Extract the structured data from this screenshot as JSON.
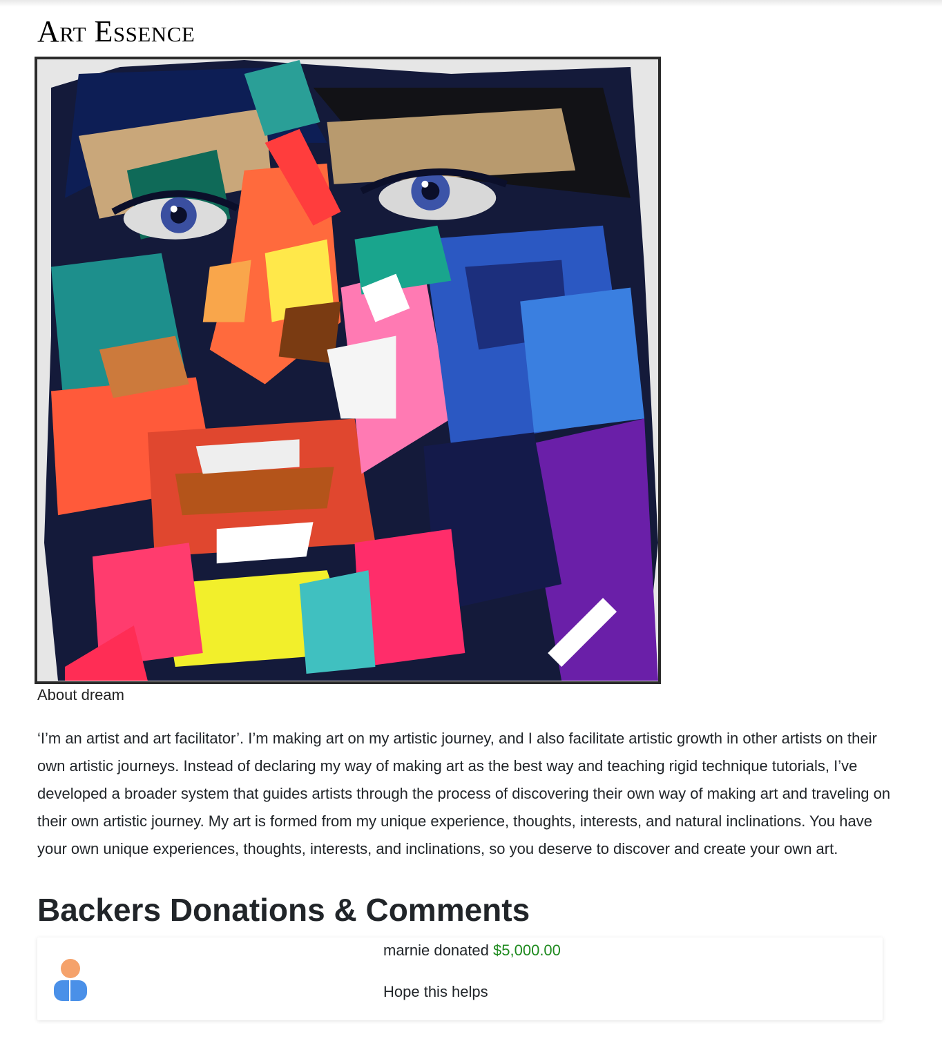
{
  "header": {
    "brand": "Art Essence"
  },
  "artwork": {
    "image_name": "colorful-face-painting",
    "caption": "About dream"
  },
  "about": {
    "text": "‘I’m an artist and art facilitator’. I’m making art on my artistic journey, and I also facilitate artistic growth in other artists on their own artistic journeys. Instead of declaring my way of making art as the best way and teaching rigid technique tutorials, I’ve developed a broader system that guides artists through the process of discovering their own way of making art and traveling on their own artistic journey. My art is formed from my unique experience, thoughts, interests, and natural inclinations. You have your own unique experiences, thoughts, interests, and inclinations, so you deserve to discover and create your own art."
  },
  "backers": {
    "title": "Backers Donations & Comments",
    "comments": [
      {
        "user": "marnie",
        "action": "donated",
        "amount": "$5,000.00",
        "message": "Hope this helps",
        "avatar_icon": "user-avatar-icon"
      }
    ]
  },
  "colors": {
    "amount": "#1e8a1e",
    "frame": "#2b2b2b",
    "text": "#212529"
  }
}
